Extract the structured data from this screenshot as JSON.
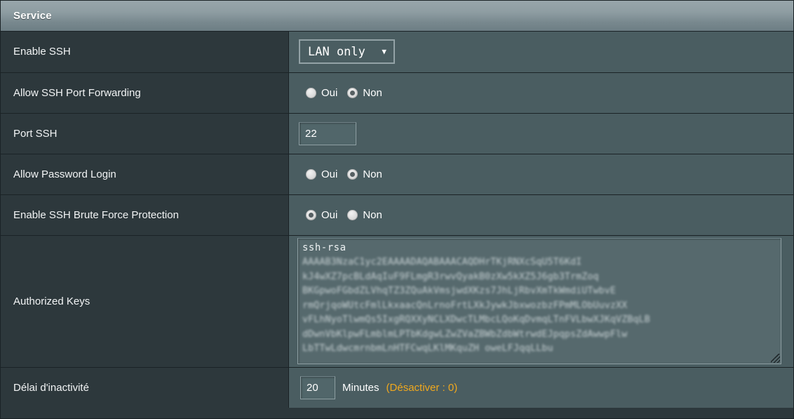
{
  "header": {
    "title": "Service"
  },
  "colors": {
    "label_column_bg": "#2d383c",
    "value_column_bg": "#4a5d61",
    "grid_line": "#1b2326",
    "text": "#ffffff",
    "hint_orange": "#f0a81e",
    "header_gradient_top": "#98a6ab",
    "header_gradient_bottom": "#6d7e84"
  },
  "rows": {
    "enable_ssh": {
      "label": "Enable SSH",
      "select_value": "LAN only",
      "select_arrow": "▼",
      "options": [
        "LAN only"
      ]
    },
    "port_forwarding": {
      "label": "Allow SSH Port Forwarding",
      "options": [
        {
          "label": "Oui",
          "checked": false
        },
        {
          "label": "Non",
          "checked": true
        }
      ]
    },
    "port_ssh": {
      "label": "Port SSH",
      "value": "22"
    },
    "password_login": {
      "label": "Allow Password Login",
      "options": [
        {
          "label": "Oui",
          "checked": false
        },
        {
          "label": "Non",
          "checked": true
        }
      ]
    },
    "brute_force": {
      "label": "Enable SSH Brute Force Protection",
      "options": [
        {
          "label": "Oui",
          "checked": true
        },
        {
          "label": "Non",
          "checked": false
        }
      ]
    },
    "authorized_keys": {
      "label": "Authorized Keys",
      "value_first_line": "ssh-rsa",
      "redacted_lines": [
        "AAAAB3NzaC1yc2EAAAADAQABAAACAQDHrTKjRNXcSqU5T6KdI",
        "kJ4wXZ7pcBLdAqIuF9FLmgR3rwvQyakB0zXw5kXZ5J6gb3TrmZoq",
        "BKGpwoFGbdZLVhqTZ3ZQuAkVmsjwdXKzs7JhLjRbvXmTkWmdiUTwbvE",
        "rmQrjqoWUtcFmlLkxaacQnLrnoFrtLXkJywkJbxwozbzFPmMLObUuvzXX",
        "vFLhNyoTlwmQs5IxgRQXXyNCLXDwcTLMbcLQoKqDvmqLTnFVLbwXJKqVZBqLB",
        "dDwnVbKlpwFLmblmLPTbKdgwLZwZVaZBWbZdbWtrwdEJpqpsZdAwwpFlw",
        "LbTTwLdwcmrnbmLnHTFCwqLKlMKquZH   oweLFJqqLLbu"
      ]
    },
    "idle_timeout": {
      "label": "Délai d'inactivité",
      "value": "20",
      "unit": "Minutes",
      "hint": "(Désactiver : 0)"
    }
  }
}
